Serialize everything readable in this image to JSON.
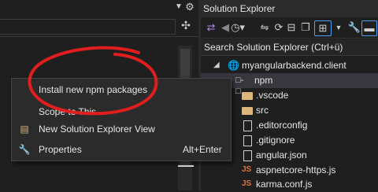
{
  "title_icons": {
    "dropdown": "chevron-down-icon",
    "gear": "gear-icon",
    "pin": "pin-icon"
  },
  "solution_explorer": {
    "title": "Solution Explorer",
    "search_placeholder": "Search Solution Explorer (Ctrl+ü)",
    "tree": [
      {
        "label": "myangularbackend.client",
        "icon": "globe-icon",
        "indent": 1
      },
      {
        "label": "npm",
        "icon": "npm-icon",
        "selected": true
      },
      {
        "label": ".vscode",
        "icon": "folder-icon"
      },
      {
        "label": "src",
        "icon": "folder-icon"
      },
      {
        "label": ".editorconfig",
        "icon": "file-icon"
      },
      {
        "label": ".gitignore",
        "icon": "file-icon"
      },
      {
        "label": "angular.json",
        "icon": "file-icon"
      },
      {
        "label": "aspnetcore-https.js",
        "icon": "js-icon",
        "prefix": "JS"
      },
      {
        "label": "karma.conf.js",
        "icon": "js-icon",
        "prefix": "JS"
      }
    ]
  },
  "context_menu": {
    "items": [
      {
        "label": "Install new npm packages",
        "shortcut": ""
      },
      {
        "label": "Scope to This",
        "shortcut": ""
      },
      {
        "label": "New Solution Explorer View",
        "shortcut": "",
        "icon": "new-view-icon"
      },
      {
        "label": "Properties",
        "shortcut": "Alt+Enter",
        "icon": "wrench-icon"
      }
    ]
  },
  "colors": {
    "accent": "#4ea1f3",
    "highlight_circle": "#e01e1e",
    "folder": "#dcb67a"
  }
}
